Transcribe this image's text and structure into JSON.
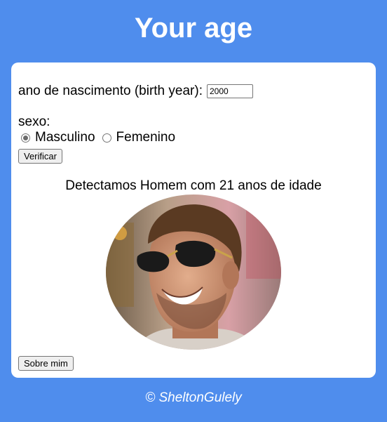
{
  "header": {
    "title": "Your age"
  },
  "form": {
    "birth_year_label": "ano de nascimento (birth year):",
    "birth_year_value": "2000",
    "sex_label": "sexo:",
    "sex_options": [
      {
        "label": "Masculino",
        "checked": true
      },
      {
        "label": "Femenino",
        "checked": false
      }
    ],
    "verify_label": "Verificar"
  },
  "result": {
    "text": "Detectamos Homem com 21 anos de idade",
    "photo_icon": "man-portrait"
  },
  "about_label": "Sobre mim",
  "footer": {
    "text": "© SheltonGulely"
  },
  "colors": {
    "background": "#4f8ded",
    "card": "#ffffff"
  }
}
